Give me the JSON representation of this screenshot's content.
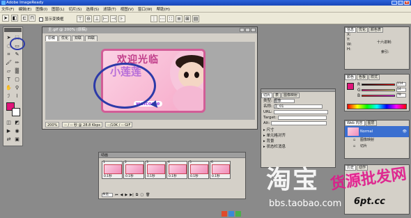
{
  "app": {
    "title": "Adobe ImageReady"
  },
  "menu": [
    "文件(F)",
    "编辑(E)",
    "图像(I)",
    "图层(L)",
    "切片(S)",
    "选择(S)",
    "滤镜(T)",
    "视图(V)",
    "窗口(W)",
    "帮助(H)"
  ],
  "options": {
    "checkbox_label": "显示变换框"
  },
  "document": {
    "title": "主.gif @ 200% (原稿)",
    "tabs": [
      "原稿",
      "优化",
      "双联",
      "四联"
    ],
    "active_tab": 0,
    "art_text": {
      "line1": "欢迎光临",
      "line2": "小莲莲",
      "line3": "welcome"
    },
    "status": [
      "200%",
      "-- / -- 秒 @ 28.8 Kbps",
      "--/10K / -- GIF"
    ]
  },
  "slice_panel": {
    "tabs": [
      "切片",
      "表",
      "图像映射"
    ],
    "type_label": "类型:",
    "type_value": "图像",
    "name_label": "名称:",
    "name_value": "主_01",
    "url_label": "URL:",
    "target_label": "Target:",
    "alt_label": "Alt:",
    "sections": [
      "尺寸",
      "单元格对齐",
      "背景",
      "状态栏消息"
    ]
  },
  "info_panel": {
    "tabs": [
      "信息",
      "优化",
      "颜色表"
    ],
    "rows": [
      {
        "k": "X:",
        "v": ""
      },
      {
        "k": "Y:",
        "v": ""
      },
      {
        "k": "W:",
        "v": ""
      },
      {
        "k": "H:",
        "v": ""
      }
    ],
    "hex_label": "十六进制:",
    "index_label": "索引:"
  },
  "color_panel": {
    "tabs": [
      "颜色",
      "色板",
      "样式"
    ],
    "channels": [
      {
        "k": "R",
        "v": "114"
      },
      {
        "k": "G",
        "v": "14"
      },
      {
        "k": "B",
        "v": "78"
      }
    ],
    "foreground": "#e0157a"
  },
  "web_panel": {
    "tabs": [
      "Web 内容",
      "图层"
    ],
    "items": [
      "Normal",
      "图像映射",
      "切片"
    ]
  },
  "history_panel": {
    "tabs": [
      "历史",
      "动作"
    ]
  },
  "animation_panel": {
    "title": "动画",
    "frames": [
      {
        "n": "1",
        "d": "0.1秒"
      },
      {
        "n": "2",
        "d": "0.1秒"
      },
      {
        "n": "3",
        "d": "0.1秒"
      },
      {
        "n": "4",
        "d": "0.1秒"
      },
      {
        "n": "5",
        "d": "0.1秒"
      },
      {
        "n": "6",
        "d": "0.1秒"
      }
    ],
    "loop": "永远"
  },
  "watermark": {
    "logo": "淘宝",
    "url": "bbs.taobao.com"
  },
  "stamp": {
    "text1": "货源批发网",
    "text2": "6pt.cc"
  }
}
